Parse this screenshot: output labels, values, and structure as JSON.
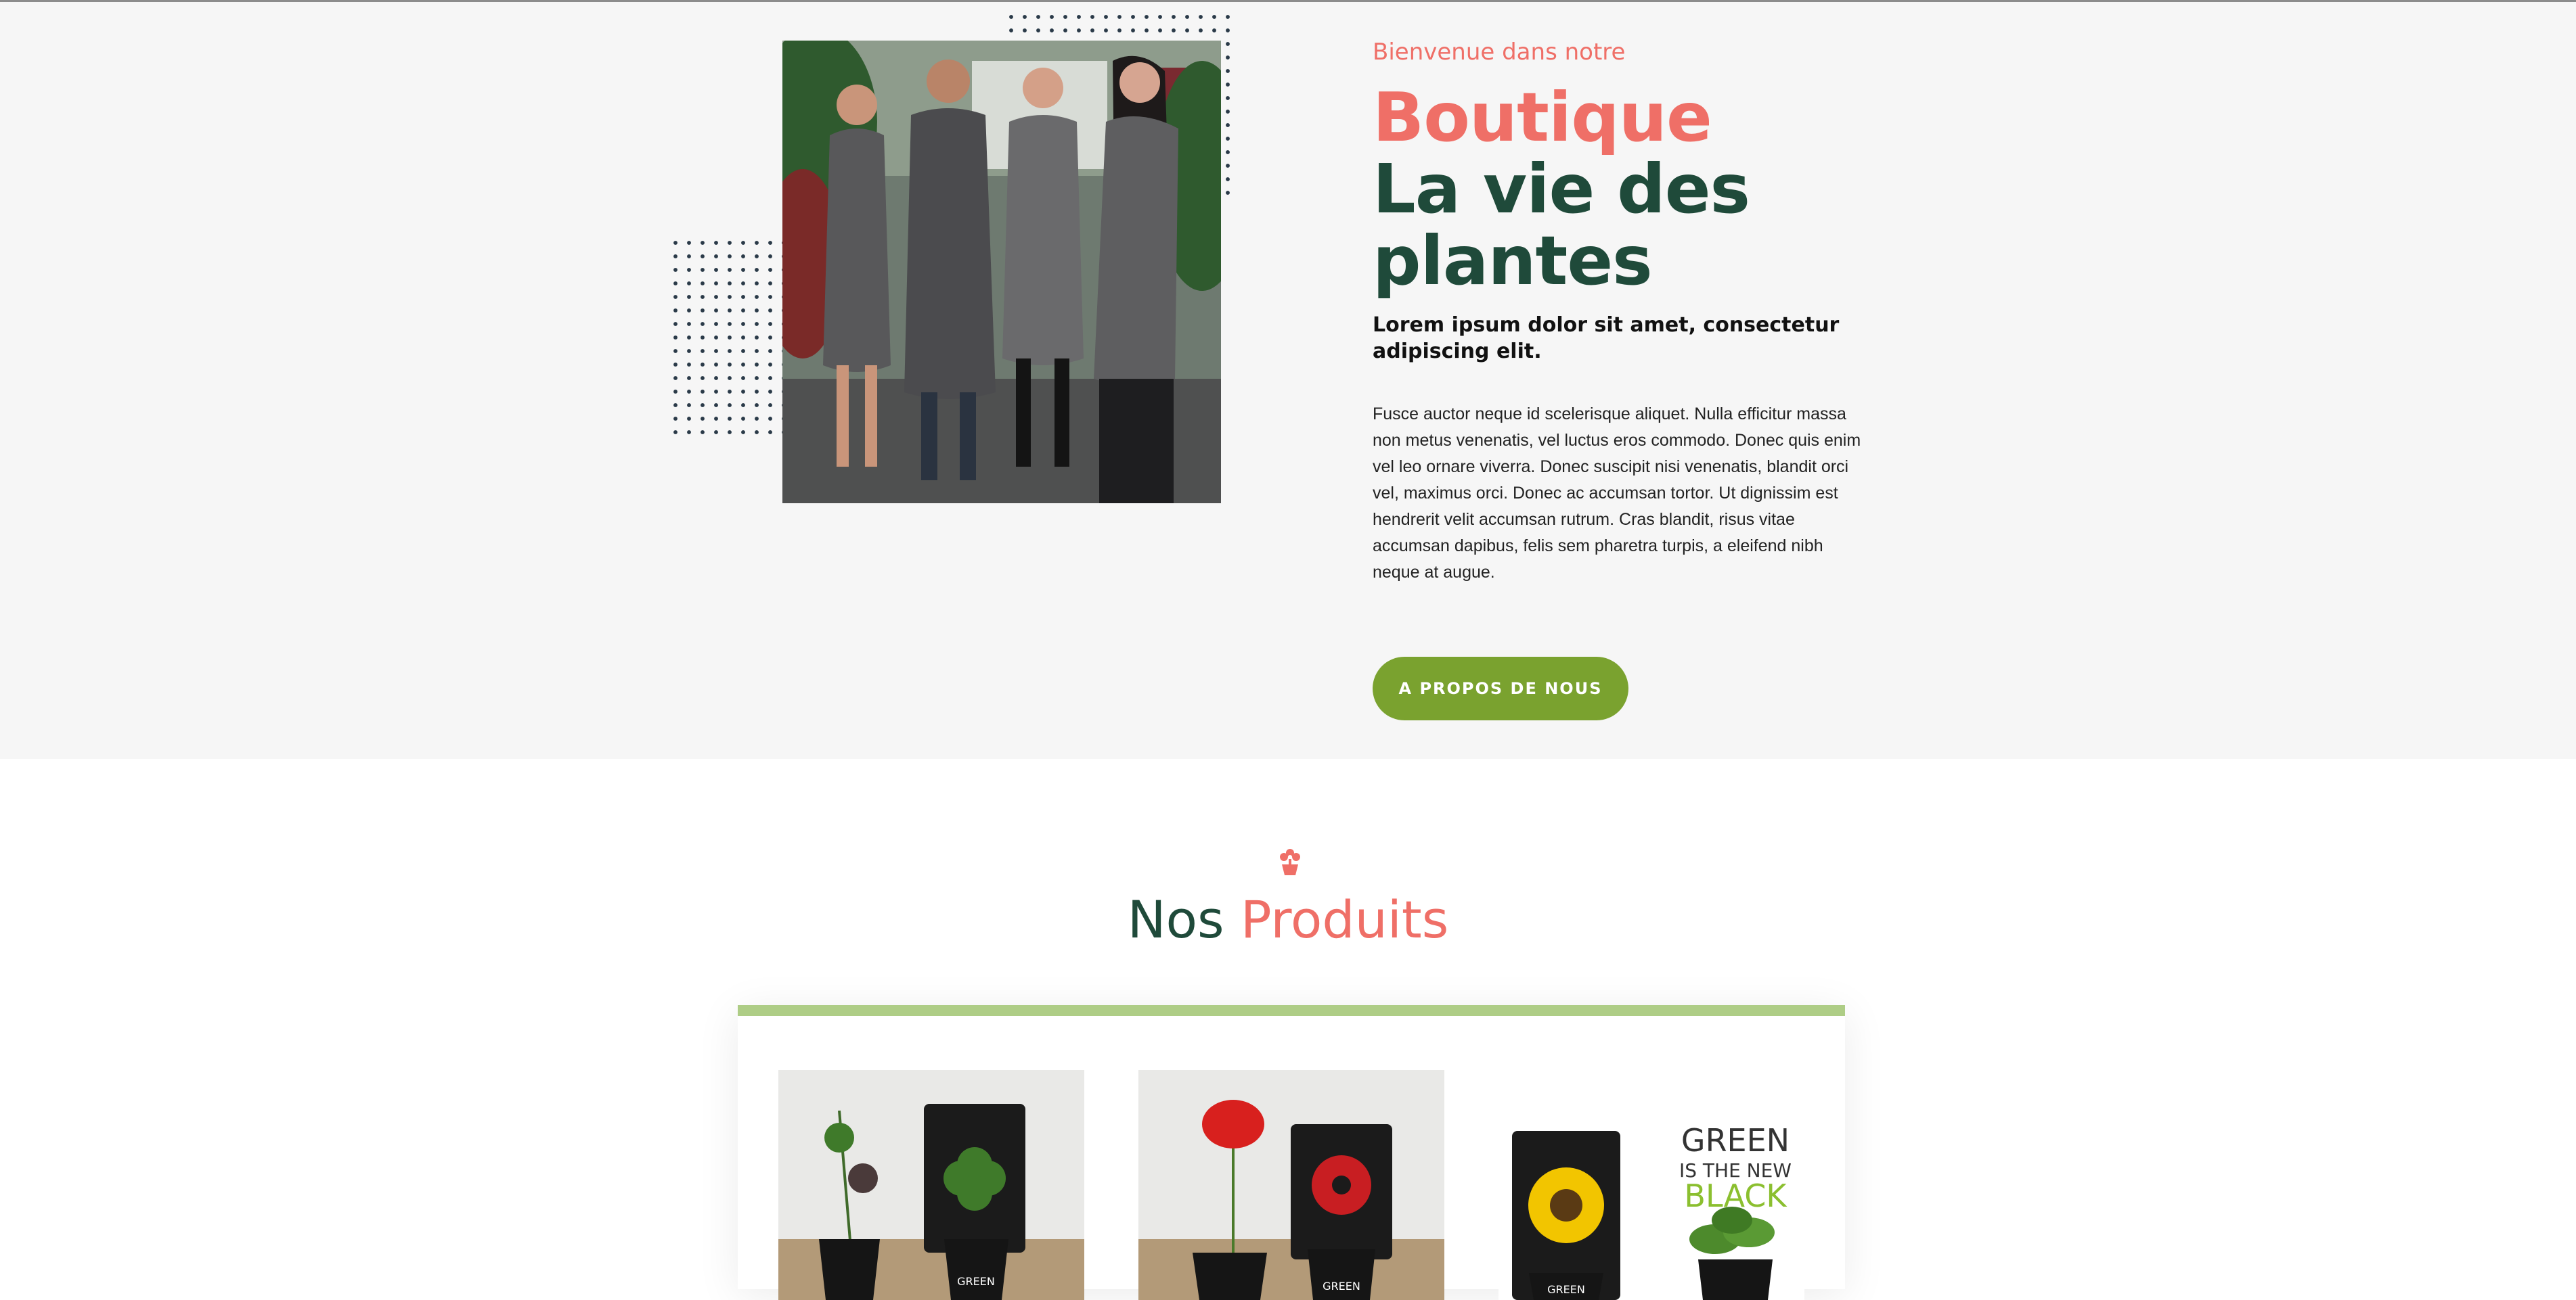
{
  "about": {
    "welcome": "Bienvenue dans notre",
    "title_line1": "Boutique",
    "title_line2": "La vie des plantes",
    "lead": "Lorem ipsum dolor sit amet, consectetur adipiscing elit.",
    "body": "Fusce auctor neque id scelerisque aliquet. Nulla efficitur massa non metus venenatis, vel luctus eros commodo. Donec quis enim vel leo ornare viverra. Donec suscipit nisi venenatis, blandit orci vel, maximus orci. Donec ac accumsan tortor. Ut dignissim est hendrerit velit accumsan rutrum. Cras blandit, risus vitae accumsan dapibus, felis sem pharetra turpis, a eleifend nibh neque at augue.",
    "cta_label": "A PROPOS DE NOUS",
    "photo_icon": "team-photo"
  },
  "products": {
    "icon": "flower-pot-icon",
    "title_word1": "Nos",
    "title_word2": "Produits",
    "items": [
      {
        "name": "clover-plant",
        "image": "clover-pot-photo",
        "pot_text": "GREEN"
      },
      {
        "name": "poppy-plant",
        "image": "poppy-pot-photo",
        "pot_text": "GREEN"
      },
      {
        "name": "sunflower-plant",
        "image": "sunflower-pot-photo",
        "pot_text": "GREEN",
        "slogan": [
          "GREEN",
          "IS THE NEW",
          "BLACK"
        ]
      }
    ]
  },
  "colors": {
    "accent_coral": "#ef6f67",
    "dark_green": "#1f4a3a",
    "button_green": "#7aa22f",
    "card_top_border": "#aecd86",
    "hero_background": "#f6f6f6"
  }
}
